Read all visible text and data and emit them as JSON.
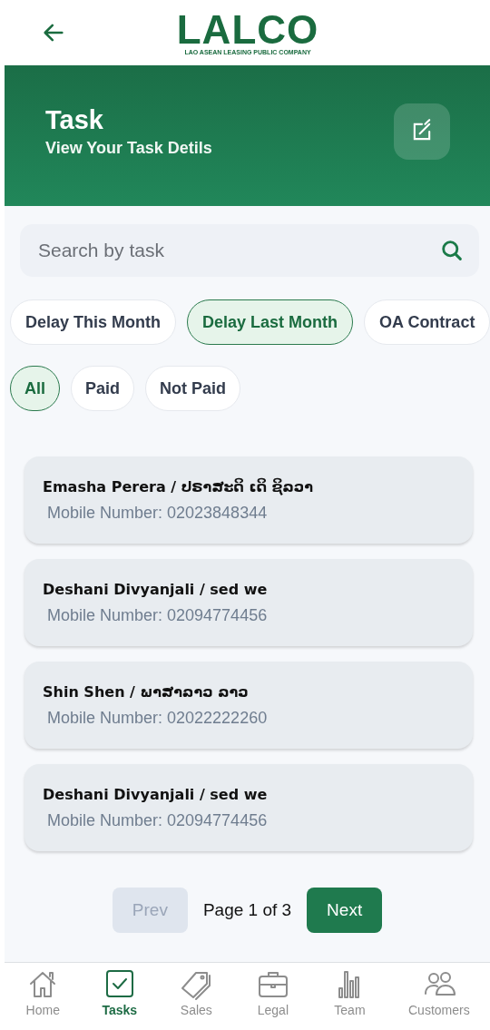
{
  "header": {
    "logo": "LALCO",
    "logo_subtitle": "LAO ASEAN LEASING PUBLIC COMPANY"
  },
  "banner": {
    "title": "Task",
    "subtitle": "View Your Task Detils"
  },
  "search": {
    "placeholder": "Search by task"
  },
  "categories": [
    {
      "label": "Delay This Month",
      "selected": false
    },
    {
      "label": "Delay Last Month",
      "selected": true
    },
    {
      "label": "OA Contract",
      "selected": false
    }
  ],
  "payment_filters": [
    {
      "label": "All",
      "selected": true
    },
    {
      "label": "Paid",
      "selected": false
    },
    {
      "label": "Not Paid",
      "selected": false
    }
  ],
  "tasks": [
    {
      "name": "Emasha Perera / ປຣາສະດິ ເດິ ຊິລວາ",
      "mobile": "Mobile Number: 02023848344"
    },
    {
      "name": "Deshani Divyanjali / sed we",
      "mobile": "Mobile Number: 02094774456"
    },
    {
      "name": "Shin Shen / ພາສາລາວ ລາວ",
      "mobile": "Mobile Number: 02022222260"
    },
    {
      "name": "Deshani Divyanjali / sed we",
      "mobile": "Mobile Number: 02094774456"
    }
  ],
  "pagination": {
    "prev": {
      "label": "Prev",
      "disabled": true
    },
    "page_label": "Page 1 of 3",
    "next": {
      "label": "Next",
      "disabled": false
    }
  },
  "nav": [
    {
      "kind": "home",
      "label": "Home",
      "selected": false
    },
    {
      "kind": "tasks",
      "label": "Tasks",
      "selected": true
    },
    {
      "kind": "sales",
      "label": "Sales",
      "selected": false
    },
    {
      "kind": "legal",
      "label": "Legal",
      "selected": false
    },
    {
      "kind": "team",
      "label": "Team",
      "selected": false
    },
    {
      "kind": "customers",
      "label": "Customers",
      "selected": false
    }
  ]
}
